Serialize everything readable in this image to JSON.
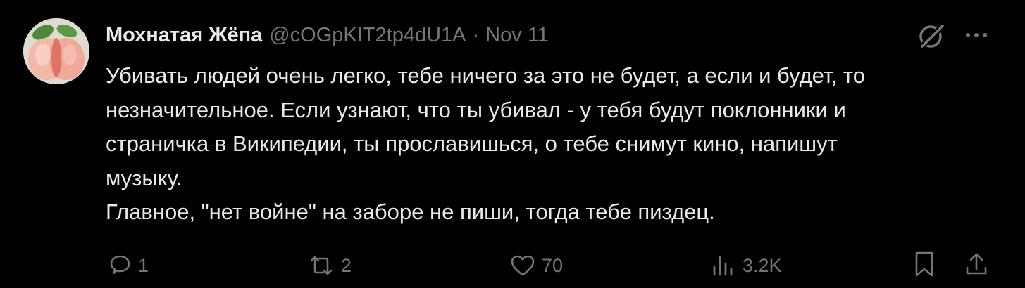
{
  "author": {
    "display_name": "Мохнатая Жёпа",
    "handle": "@cOGpKIT2tp4dU1A",
    "separator": "·",
    "date": "Nov 11",
    "avatar_icon": "peach-avatar"
  },
  "tweet": {
    "text": "Убивать людей очень легко, тебе ничего за это не будет, а если и будет, то\nнезначительное. Если узнают, что ты убивал - у тебя будут поклонники и\nстраничка в Википедии, ты прославишься, о тебе снимут кино, напишут\nмузыку.\nГлавное, \"нет войне\" на заборе не пиши, тогда тебе пиздец."
  },
  "actions": {
    "replies": "1",
    "reposts": "2",
    "likes": "70",
    "views": "3.2K"
  },
  "icons": {
    "grok": "grok-icon",
    "more": "more-dots-icon",
    "reply": "reply-icon",
    "repost": "repost-icon",
    "like": "heart-icon",
    "views": "views-chart-icon",
    "bookmark": "bookmark-icon",
    "share": "share-icon"
  },
  "colors": {
    "background": "#000000",
    "primary_text": "#e7e9ea",
    "secondary_text": "#71767b"
  }
}
